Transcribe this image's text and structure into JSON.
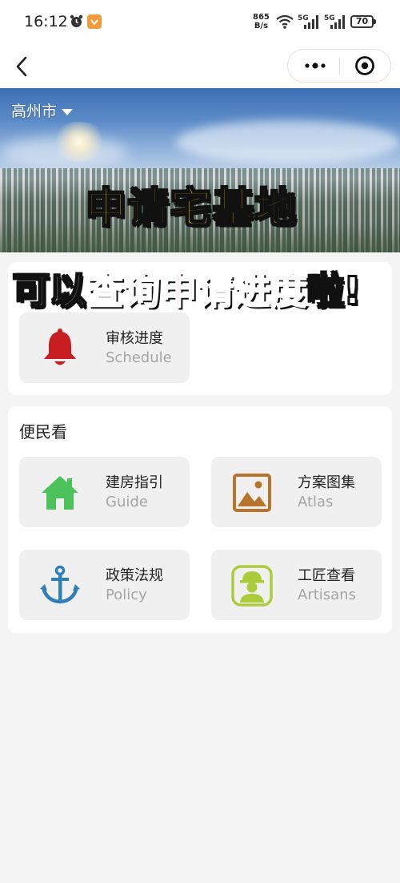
{
  "status": {
    "time": "16:12",
    "net_speed_value": "865",
    "net_speed_unit": "B/s",
    "battery": "70",
    "network_labels": [
      "5G",
      "5G"
    ]
  },
  "navbar": {
    "back_icon": "chevron-left-icon",
    "more_icon": "more-dots-icon",
    "close_icon": "target-circle-icon"
  },
  "banner": {
    "city": "高州市"
  },
  "overlay": {
    "line1": "申请宅基地",
    "line2_prefix": "可以",
    "line2_highlight": "查询申请进度",
    "line2_suffix": "啦!"
  },
  "apply_section": {
    "tiles": [
      {
        "title": "审核进度",
        "subtitle": "Schedule",
        "icon": "bell-icon",
        "color": "#c81e22"
      }
    ]
  },
  "service_section": {
    "title": "便民看",
    "tiles": [
      {
        "title": "建房指引",
        "subtitle": "Guide",
        "icon": "house-icon",
        "color": "#4cc35a"
      },
      {
        "title": "方案图集",
        "subtitle": "Atlas",
        "icon": "picture-icon",
        "color": "#b8742a"
      },
      {
        "title": "政策法规",
        "subtitle": "Policy",
        "icon": "anchor-icon",
        "color": "#2f7fb8"
      },
      {
        "title": "工匠查看",
        "subtitle": "Artisans",
        "icon": "worker-icon",
        "color": "#aacb3a"
      }
    ]
  }
}
